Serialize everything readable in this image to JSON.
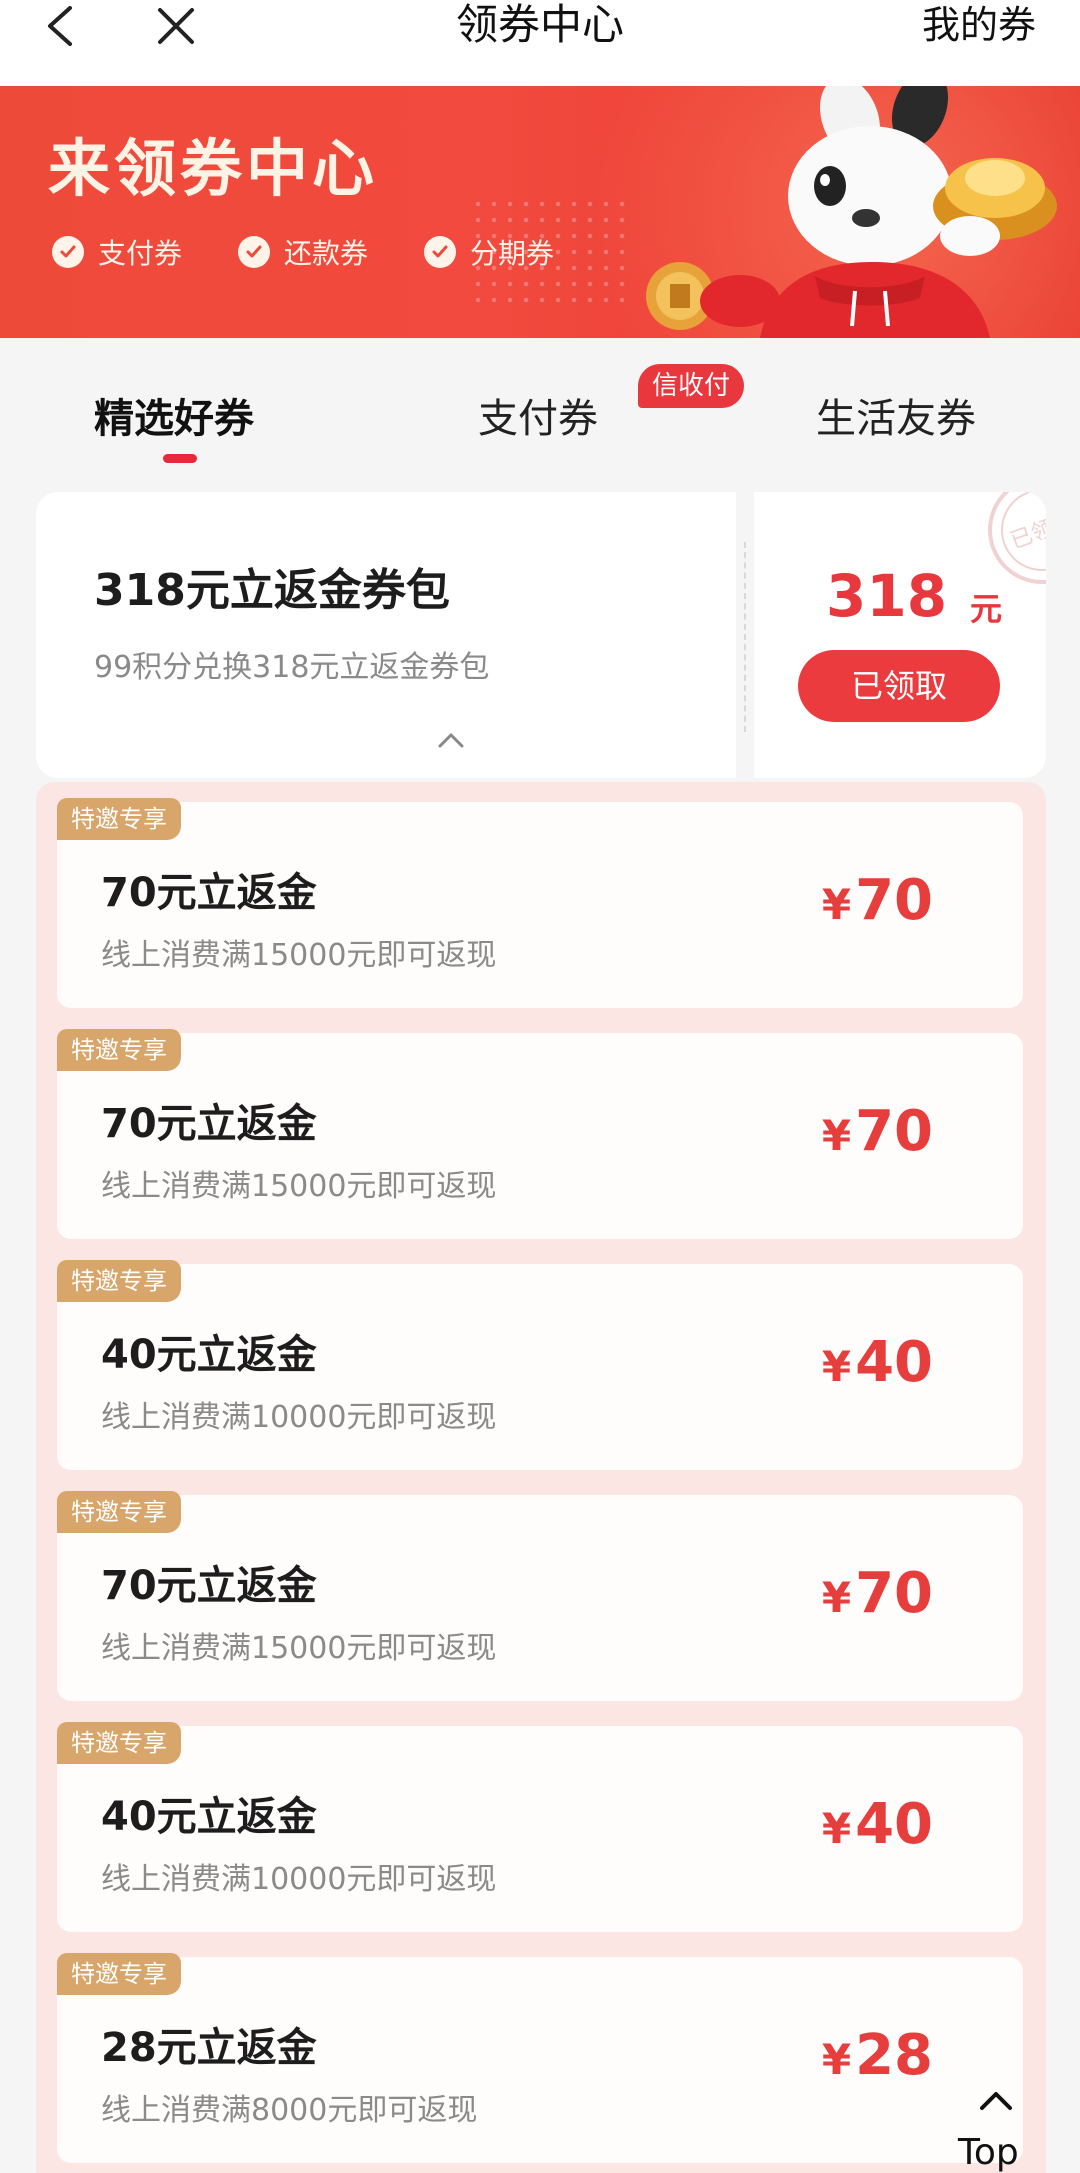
{
  "nav": {
    "title": "领券中心",
    "my_coupons": "我的券"
  },
  "banner": {
    "title": "来领券中心",
    "tags": [
      "支付券",
      "还款券",
      "分期券"
    ]
  },
  "tabs": {
    "items": [
      "精选好券",
      "支付券",
      "生活友券"
    ],
    "active_index": 0,
    "badge": "信收付"
  },
  "pack": {
    "title": "318元立返金券包",
    "subtitle": "99积分兑换318元立返金券包",
    "amount": "318",
    "unit": "元",
    "button": "已领取",
    "stamp": "已领取"
  },
  "coupons": [
    {
      "ribbon": "特邀专享",
      "title": "70元立返金",
      "desc": "线上消费满15000元即可返现",
      "amount": "70"
    },
    {
      "ribbon": "特邀专享",
      "title": "70元立返金",
      "desc": "线上消费满15000元即可返现",
      "amount": "70"
    },
    {
      "ribbon": "特邀专享",
      "title": "40元立返金",
      "desc": "线上消费满10000元即可返现",
      "amount": "40"
    },
    {
      "ribbon": "特邀专享",
      "title": "70元立返金",
      "desc": "线上消费满15000元即可返现",
      "amount": "70"
    },
    {
      "ribbon": "特邀专享",
      "title": "40元立返金",
      "desc": "线上消费满10000元即可返现",
      "amount": "40"
    },
    {
      "ribbon": "特邀专享",
      "title": "28元立返金",
      "desc": "线上消费满8000元即可返现",
      "amount": "28"
    }
  ],
  "currency_symbol": "¥",
  "top_button": "Top",
  "colors": {
    "accent_red": "#e8373d",
    "ribbon_gold": "#d8a56a",
    "list_background": "#fbe6e4"
  }
}
